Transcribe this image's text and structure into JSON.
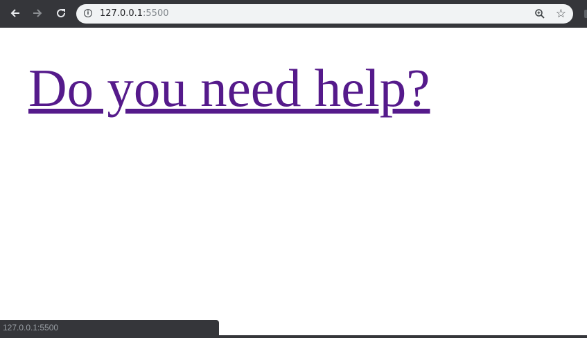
{
  "browser": {
    "back_icon": "arrow-left-icon",
    "forward_icon": "arrow-right-icon",
    "reload_icon": "reload-icon",
    "back_glyph": "🡐",
    "forward_glyph": "🡒",
    "reload_glyph": "⟳",
    "address": {
      "host": "127.0.0.1",
      "port": ":5500"
    },
    "zoom_icon": "zoom-in-icon",
    "star_glyph": "☆",
    "toolbar_color": "#35363a"
  },
  "page": {
    "link_text": "Do you need help?",
    "link_color": "#551a8b"
  },
  "status_bar": {
    "text": "127.0.0.1:5500"
  }
}
